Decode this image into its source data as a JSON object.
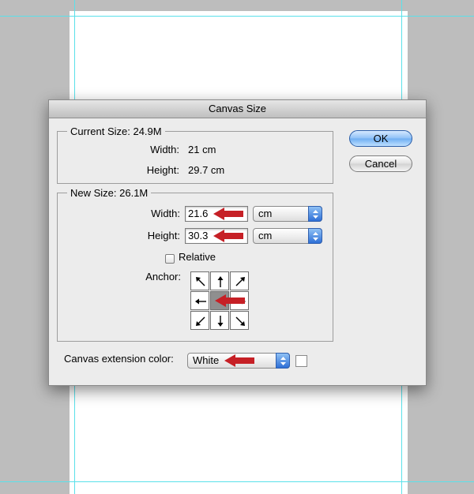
{
  "dialog": {
    "title": "Canvas Size"
  },
  "current_size": {
    "legend": "Current Size: 24.9M",
    "width_label": "Width:",
    "width_value": "21 cm",
    "height_label": "Height:",
    "height_value": "29.7 cm"
  },
  "new_size": {
    "legend": "New Size: 26.1M",
    "width_label": "Width:",
    "width_value": "21.6",
    "width_unit": "cm",
    "height_label": "Height:",
    "height_value": "30.3",
    "height_unit": "cm",
    "relative_label": "Relative",
    "relative_checked": false,
    "anchor_label": "Anchor:",
    "anchor_selected": "center"
  },
  "extension": {
    "label": "Canvas extension color:",
    "value": "White",
    "swatch_color": "#ffffff"
  },
  "buttons": {
    "ok": "OK",
    "cancel": "Cancel"
  },
  "colors": {
    "annotation_arrow": "#c62026",
    "guide": "#5ae1ea",
    "default_button": "#6eaef2"
  }
}
